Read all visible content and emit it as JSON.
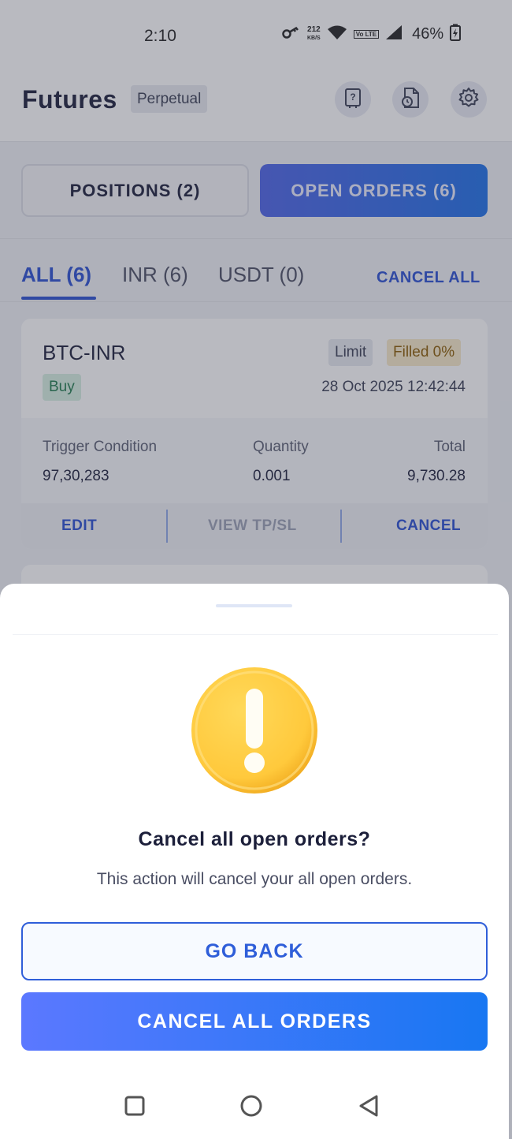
{
  "status_bar": {
    "time": "2:10",
    "net_speed_value": "212",
    "net_speed_unit": "KB/S",
    "volte_label": "Vo LTE",
    "battery": "46%"
  },
  "header": {
    "title": "Futures",
    "badge": "Perpetual"
  },
  "toggle": {
    "positions_label": "POSITIONS (2)",
    "open_orders_label": "OPEN ORDERS (6)"
  },
  "tabs": {
    "items": [
      {
        "label": "ALL (6)"
      },
      {
        "label": "INR (6)"
      },
      {
        "label": "USDT (0)"
      }
    ],
    "cancel_all": "CANCEL ALL"
  },
  "order_card": {
    "pair": "BTC-INR",
    "side": "Buy",
    "order_type": "Limit",
    "fill_status": "Filled 0%",
    "date": "28 Oct 2025",
    "time": "12:42:44",
    "trigger_label": "Trigger Condition",
    "trigger_value": "97,30,283",
    "quantity_label": "Quantity",
    "quantity_value": "0.001",
    "total_label": "Total",
    "total_value": "9,730.28",
    "edit_label": "EDIT",
    "view_tpsl_label": "VIEW TP/SL",
    "cancel_label": "CANCEL"
  },
  "dialog": {
    "title": "Cancel all open orders?",
    "message": "This action will cancel your all open orders.",
    "go_back_label": "GO BACK",
    "confirm_label": "CANCEL ALL ORDERS"
  },
  "colors": {
    "accent": "#2a4fd2",
    "primary_button_start": "#5b78ff",
    "primary_button_end": "#1877f2",
    "warning": "#ffc93c"
  },
  "icons": {
    "header": [
      "help-book-icon",
      "order-history-icon",
      "settings-gear-icon"
    ],
    "dialog": "warning-exclamation-icon",
    "nav": [
      "recents-square-icon",
      "home-circle-icon",
      "back-triangle-icon"
    ]
  }
}
